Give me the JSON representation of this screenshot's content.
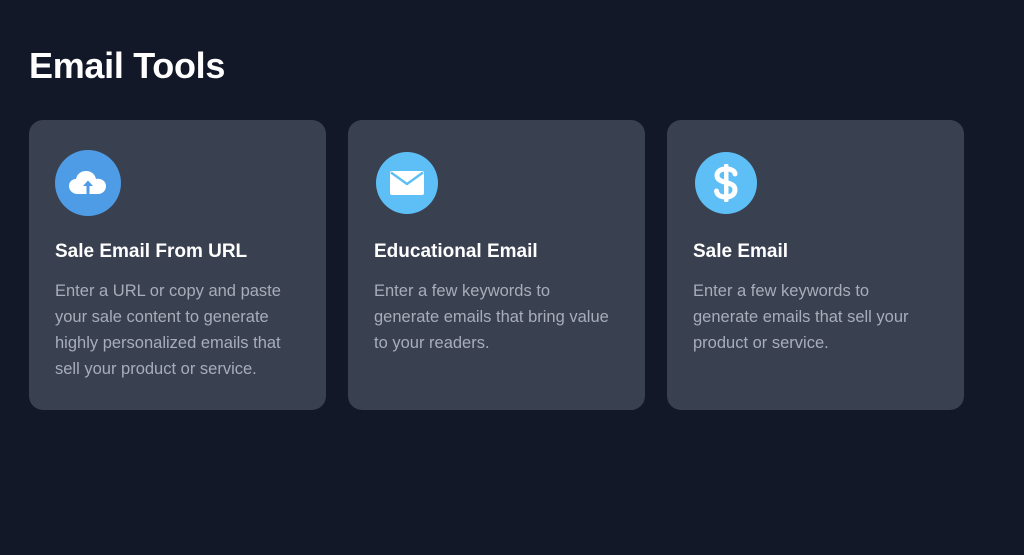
{
  "page": {
    "title": "Email Tools"
  },
  "colors": {
    "background": "#121828",
    "card": "#394050",
    "icon_cloud": "#4f9ce6",
    "icon_mail": "#5dbff5",
    "icon_dollar": "#5dbff5",
    "description_text": "#a7adba"
  },
  "cards": [
    {
      "icon": "cloud-upload-icon",
      "title": "Sale Email From URL",
      "description": "Enter a URL or copy and paste your sale content to generate highly personalized emails that sell your product or service."
    },
    {
      "icon": "envelope-icon",
      "title": "Educational Email",
      "description": "Enter a few keywords to generate emails that bring value to your readers."
    },
    {
      "icon": "dollar-icon",
      "title": "Sale Email",
      "description": "Enter a few keywords to generate emails that sell your product or service."
    }
  ]
}
